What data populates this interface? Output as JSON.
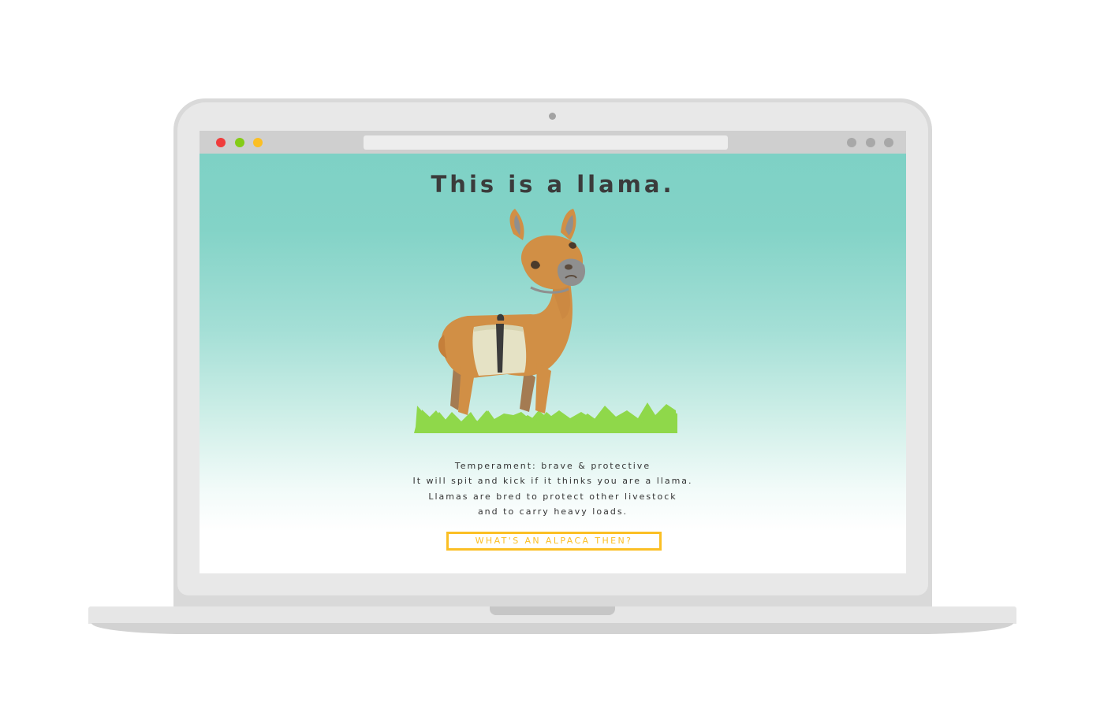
{
  "page": {
    "headline": "This is a llama.",
    "description_lines": [
      "Temperament: brave & protective",
      "It will spit and kick if it thinks you are a llama.",
      "Llamas are bred to protect other livestock",
      "and to carry heavy loads."
    ],
    "cta_label": "WHAT'S AN ALPACA THEN?"
  },
  "colors": {
    "background_top": "#7ed1c5",
    "background_bottom": "#ffffff",
    "accent": "#fbbf24",
    "llama_body": "#d18f45",
    "grass": "#8fd84a"
  },
  "icons": {
    "window_controls": [
      "close-dot",
      "minimize-dot",
      "maximize-dot"
    ],
    "illustration": "llama-illustration"
  }
}
